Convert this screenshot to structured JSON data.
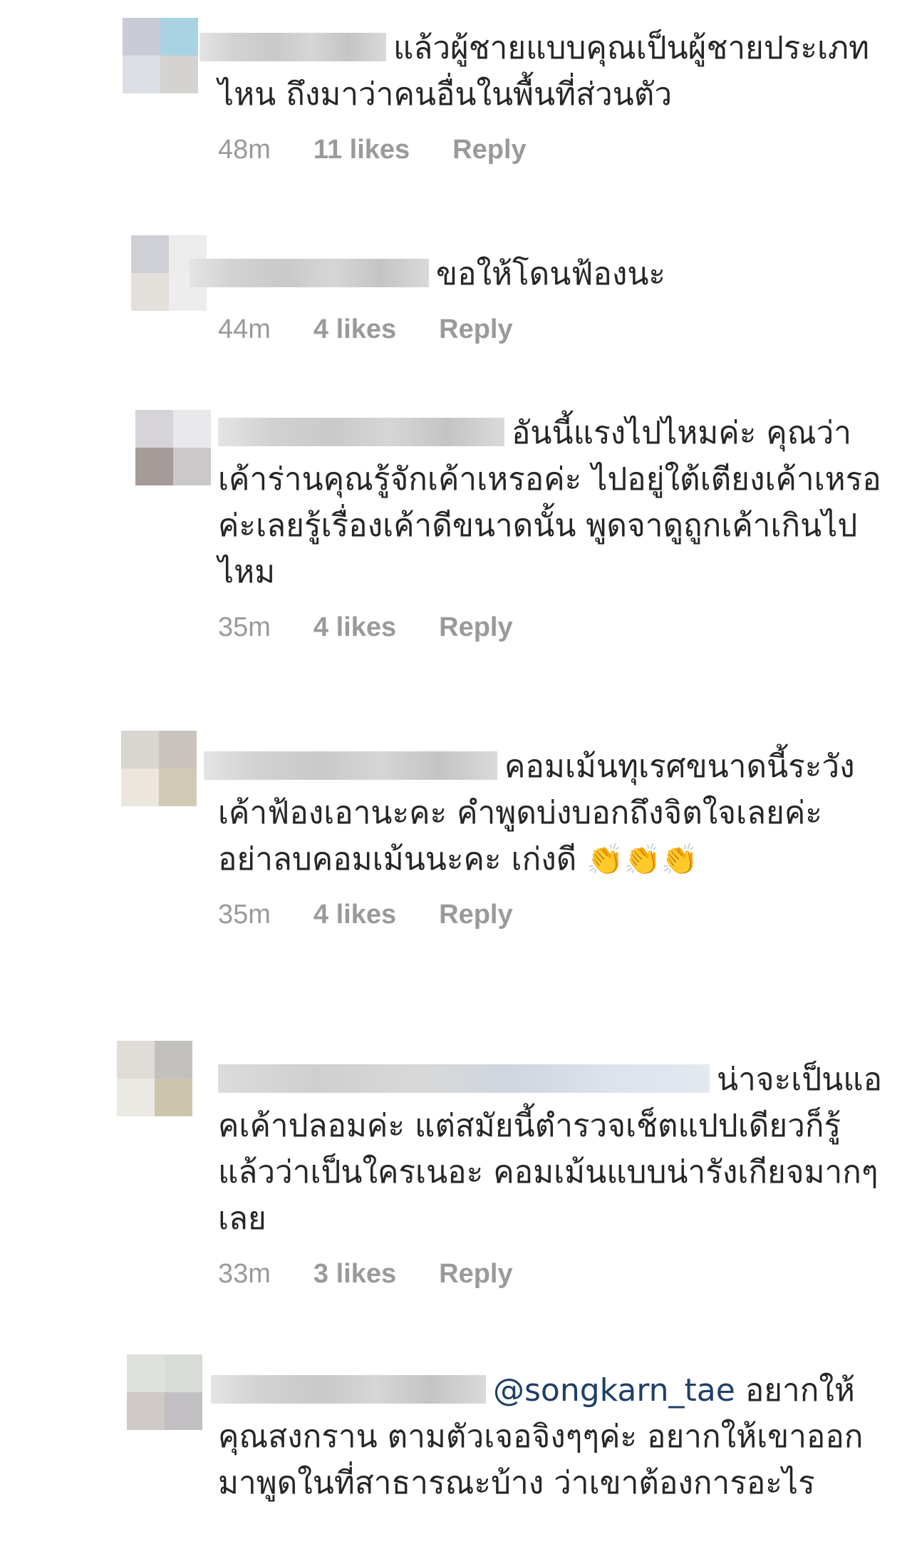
{
  "comments": [
    {
      "text": "แล้วผู้ชายแบบคุณเป็นผู้ชายประเภทไหน ถึงมาว่าคนอื่นในพื้นที่ส่วนตัว",
      "time": "48m",
      "likes": "11 likes",
      "reply": "Reply"
    },
    {
      "text": "ขอให้โดนฟ้องนะ",
      "time": "44m",
      "likes": "4 likes",
      "reply": "Reply"
    },
    {
      "text": "อันนี้แรงไปไหมค่ะ คุณว่าเค้าร่านคุณรู้จักเค้าเหรอค่ะ ไปอยู่ใต้เตียงเค้าเหรอค่ะเลยรู้เรื่องเค้าดีขนาดนั้น พูดจาดูถูกเค้าเกินไปไหม",
      "time": "35m",
      "likes": "4 likes",
      "reply": "Reply"
    },
    {
      "text": "คอมเม้นทุเรศขนาดนี้ระวังเค้าฟ้องเอานะคะ คำพูดบ่งบอกถึงจิตใจเลยค่ะ อย่าลบคอมเม้นนะคะ เก่งดี",
      "emoji": "👏👏👏",
      "time": "35m",
      "likes": "4 likes",
      "reply": "Reply"
    },
    {
      "text": "น่าจะเป็นแอคเค้าปลอมค่ะ แต่สมัยนี้ตำรวจเช็ตแปปเดียวก็รู้แล้วว่าเป็นใครเนอะ คอมเม้นแบบน่ารังเกียจมากๆเลย",
      "time": "33m",
      "likes": "3 likes",
      "reply": "Reply"
    },
    {
      "mention": "@songkarn_tae",
      "text": " อยากให้คุณสงกราน ตามตัวเจอจิงๆๆค่ะ  อยากให้เขาออกมาพูดในที่สาธารณะบ้าง  ว่าเขาต้องการอะไร"
    }
  ],
  "colors": {
    "text": "#262626",
    "meta": "#9a9a9a",
    "mention": "#1f3f66"
  },
  "icons": [
    "blurred-avatar",
    "blurred-username",
    "clapping-hands-emoji"
  ]
}
